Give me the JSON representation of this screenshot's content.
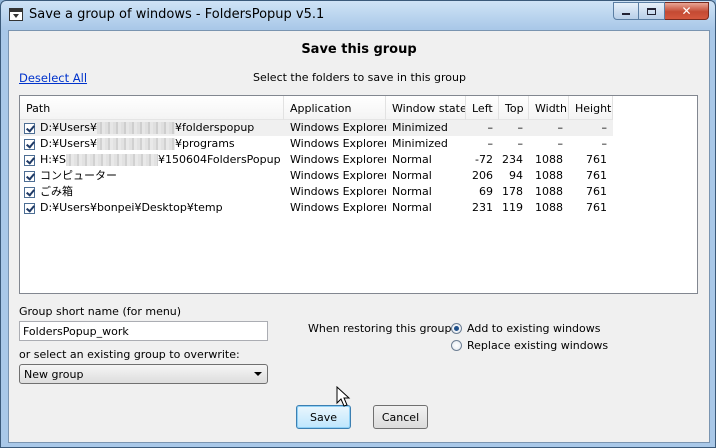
{
  "window": {
    "title": "Save a group of windows - FoldersPopup v5.1"
  },
  "header": {
    "heading": "Save this group",
    "deselect_label": "Deselect All",
    "instruction": "Select the folders to save in this group"
  },
  "table": {
    "columns": [
      "Path",
      "Application",
      "Window state",
      "Left",
      "Top",
      "Width",
      "Height"
    ],
    "rows": [
      {
        "checked": true,
        "path_prefix": "D:¥Users¥",
        "path_suffix": "¥folderspopup",
        "redacted": true,
        "application": "Windows Explorer",
        "state": "Minimized",
        "left": "–",
        "top": "–",
        "width": "–",
        "height": "–"
      },
      {
        "checked": true,
        "path_prefix": "D:¥Users¥",
        "path_suffix": "¥programs",
        "redacted": true,
        "application": "Windows Explorer",
        "state": "Minimized",
        "left": "–",
        "top": "–",
        "width": "–",
        "height": "–"
      },
      {
        "checked": true,
        "path_prefix": "H:¥S",
        "path_suffix": "¥150604FoldersPopup",
        "redacted": true,
        "application": "Windows Explorer",
        "state": "Normal",
        "left": "-72",
        "top": "234",
        "width": "1088",
        "height": "761"
      },
      {
        "checked": true,
        "path_prefix": "コンピューター",
        "path_suffix": "",
        "redacted": false,
        "application": "Windows Explorer",
        "state": "Normal",
        "left": "206",
        "top": "94",
        "width": "1088",
        "height": "761"
      },
      {
        "checked": true,
        "path_prefix": "ごみ箱",
        "path_suffix": "",
        "redacted": false,
        "application": "Windows Explorer",
        "state": "Normal",
        "left": "69",
        "top": "178",
        "width": "1088",
        "height": "761"
      },
      {
        "checked": true,
        "path_prefix": "D:¥Users¥bonpei¥Desktop¥temp",
        "path_suffix": "",
        "redacted": false,
        "application": "Windows Explorer",
        "state": "Normal",
        "left": "231",
        "top": "119",
        "width": "1088",
        "height": "761"
      }
    ]
  },
  "form": {
    "group_name_label": "Group short name (for menu)",
    "group_name_value": "FoldersPopup_work",
    "overwrite_label": "or select an existing group to overwrite:",
    "overwrite_selected": "New group",
    "restore_label": "When restoring this group:",
    "restore_options": [
      {
        "label": "Add to existing windows",
        "checked": true
      },
      {
        "label": "Replace existing windows",
        "checked": false
      }
    ]
  },
  "buttons": {
    "save": "Save",
    "cancel": "Cancel"
  }
}
